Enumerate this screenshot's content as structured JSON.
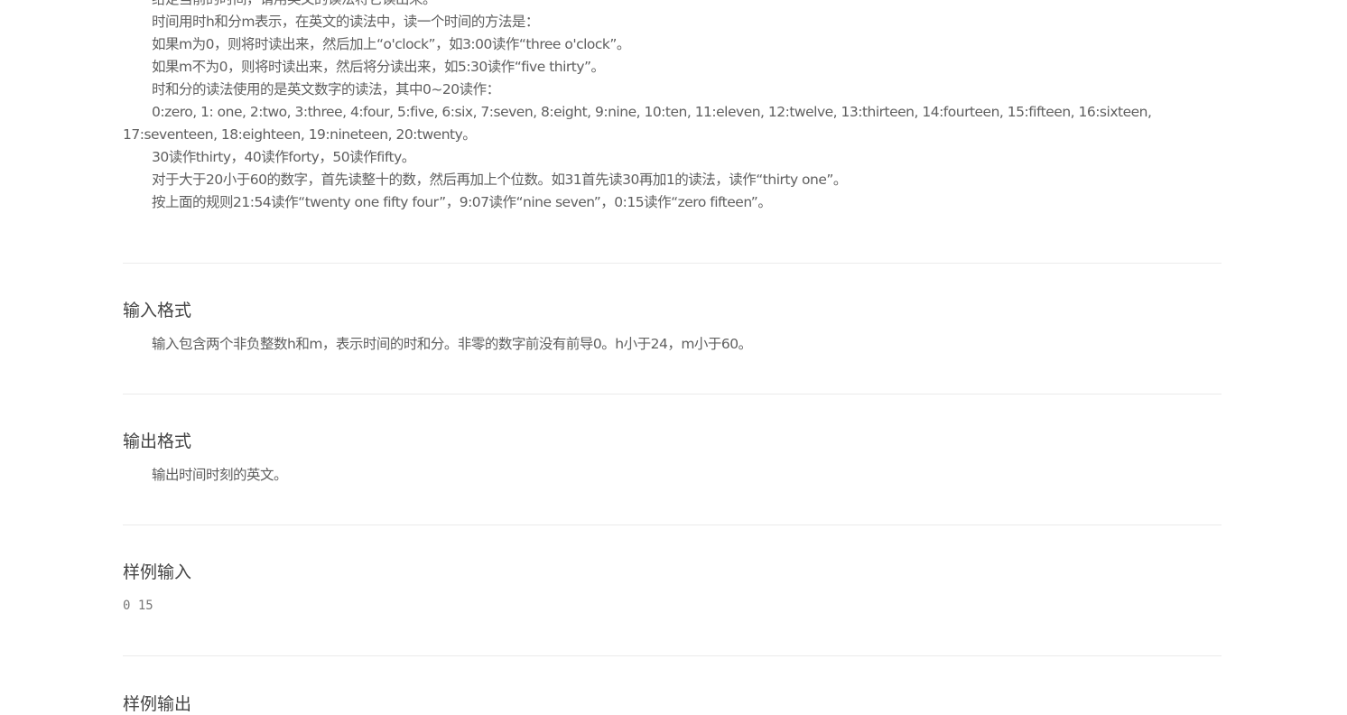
{
  "description": {
    "lines": [
      "给定当前的时间，请用英文的读法将它读出来。",
      "时间用时h和分m表示，在英文的读法中，读一个时间的方法是：",
      "如果m为0，则将时读出来，然后加上“o'clock”，如3:00读作“three o'clock”。",
      "如果m不为0，则将时读出来，然后将分读出来，如5:30读作“five thirty”。",
      "时和分的读法使用的是英文数字的读法，其中0~20读作：",
      "0:zero, 1: one, 2:two, 3:three, 4:four, 5:five, 6:six, 7:seven, 8:eight, 9:nine, 10:ten, 11:eleven, 12:twelve, 13:thirteen, 14:fourteen, 15:fifteen, 16:sixteen, 17:seventeen, 18:eighteen, 19:nineteen, 20:twenty。",
      "30读作thirty，40读作forty，50读作fifty。",
      "对于大于20小于60的数字，首先读整十的数，然后再加上个位数。如31首先读30再加1的读法，读作“thirty one”。",
      "按上面的规则21:54读作“twenty one fifty four”，9:07读作“nine seven”，0:15读作“zero fifteen”。"
    ]
  },
  "input_format": {
    "title": "输入格式",
    "text": "输入包含两个非负整数h和m，表示时间的时和分。非零的数字前没有前导0。h小于24，m小于60。"
  },
  "output_format": {
    "title": "输出格式",
    "text": "输出时间时刻的英文。"
  },
  "sample_input": {
    "title": "样例输入",
    "text": "0 15"
  },
  "sample_output": {
    "title": "样例输出"
  }
}
